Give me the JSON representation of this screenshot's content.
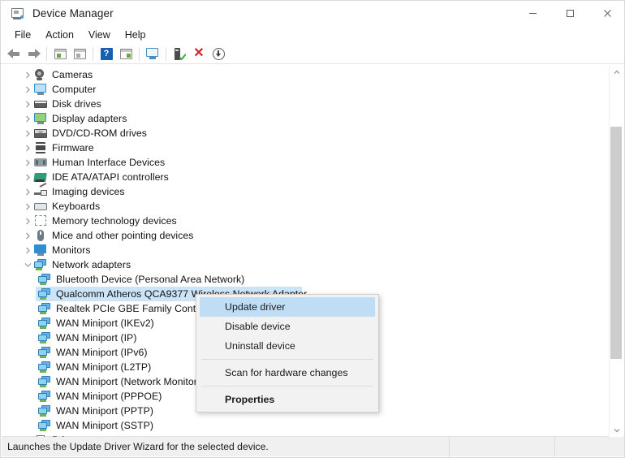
{
  "window": {
    "title": "Device Manager",
    "title_icon": "device-manager-icon",
    "controls": {
      "minimize": "minimize-icon",
      "maximize": "maximize-icon",
      "close": "close-icon"
    }
  },
  "menubar": {
    "items": [
      {
        "label": "File"
      },
      {
        "label": "Action"
      },
      {
        "label": "View"
      },
      {
        "label": "Help"
      }
    ]
  },
  "toolbar": {
    "buttons": [
      {
        "name": "back-button",
        "icon": "back-arrow-icon"
      },
      {
        "name": "forward-button",
        "icon": "forward-arrow-icon"
      },
      {
        "name": "show-hide-console-tree-button",
        "icon": "console-tree-icon"
      },
      {
        "name": "show-hide-action-pane-button",
        "icon": "action-pane-icon"
      },
      {
        "name": "help-button",
        "icon": "help-question-icon"
      },
      {
        "name": "properties-button",
        "icon": "properties-panel-icon"
      },
      {
        "name": "scan-monitor-button",
        "icon": "monitor-icon"
      },
      {
        "name": "update-driver-software-button",
        "icon": "update-driver-green-icon"
      },
      {
        "name": "uninstall-device-button",
        "icon": "red-x-icon"
      },
      {
        "name": "scan-for-hardware-changes-button",
        "icon": "circle-down-arrow-icon"
      }
    ]
  },
  "tree": {
    "nodes": [
      {
        "label": "Cameras",
        "icon": "camera-icon",
        "level": 0,
        "state": "collapsed"
      },
      {
        "label": "Computer",
        "icon": "computer-icon",
        "level": 0,
        "state": "collapsed"
      },
      {
        "label": "Disk drives",
        "icon": "disk-drive-icon",
        "level": 0,
        "state": "collapsed"
      },
      {
        "label": "Display adapters",
        "icon": "display-adapter-icon",
        "level": 0,
        "state": "collapsed"
      },
      {
        "label": "DVD/CD-ROM drives",
        "icon": "dvd-drive-icon",
        "level": 0,
        "state": "collapsed"
      },
      {
        "label": "Firmware",
        "icon": "firmware-icon",
        "level": 0,
        "state": "collapsed"
      },
      {
        "label": "Human Interface Devices",
        "icon": "hid-icon",
        "level": 0,
        "state": "collapsed"
      },
      {
        "label": "IDE ATA/ATAPI controllers",
        "icon": "ide-controller-icon",
        "level": 0,
        "state": "collapsed"
      },
      {
        "label": "Imaging devices",
        "icon": "imaging-device-icon",
        "level": 0,
        "state": "collapsed"
      },
      {
        "label": "Keyboards",
        "icon": "keyboard-icon",
        "level": 0,
        "state": "collapsed"
      },
      {
        "label": "Memory technology devices",
        "icon": "memory-technology-icon",
        "level": 0,
        "state": "collapsed"
      },
      {
        "label": "Mice and other pointing devices",
        "icon": "mouse-icon",
        "level": 0,
        "state": "collapsed"
      },
      {
        "label": "Monitors",
        "icon": "monitor-icon",
        "level": 0,
        "state": "collapsed"
      },
      {
        "label": "Network adapters",
        "icon": "network-adapter-icon",
        "level": 0,
        "state": "expanded"
      },
      {
        "label": "Bluetooth Device (Personal Area Network)",
        "icon": "network-adapter-icon",
        "level": 1,
        "state": "leaf"
      },
      {
        "label": "Qualcomm Atheros QCA9377 Wireless Network Adapter",
        "icon": "network-adapter-icon",
        "level": 1,
        "state": "leaf",
        "selected": true
      },
      {
        "label": "Realtek PCIe GBE Family Controller",
        "icon": "network-adapter-icon",
        "level": 1,
        "state": "leaf"
      },
      {
        "label": "WAN Miniport (IKEv2)",
        "icon": "network-adapter-icon",
        "level": 1,
        "state": "leaf"
      },
      {
        "label": "WAN Miniport (IP)",
        "icon": "network-adapter-icon",
        "level": 1,
        "state": "leaf"
      },
      {
        "label": "WAN Miniport (IPv6)",
        "icon": "network-adapter-icon",
        "level": 1,
        "state": "leaf"
      },
      {
        "label": "WAN Miniport (L2TP)",
        "icon": "network-adapter-icon",
        "level": 1,
        "state": "leaf"
      },
      {
        "label": "WAN Miniport (Network Monitor)",
        "icon": "network-adapter-icon",
        "level": 1,
        "state": "leaf"
      },
      {
        "label": "WAN Miniport (PPPOE)",
        "icon": "network-adapter-icon",
        "level": 1,
        "state": "leaf"
      },
      {
        "label": "WAN Miniport (PPTP)",
        "icon": "network-adapter-icon",
        "level": 1,
        "state": "leaf"
      },
      {
        "label": "WAN Miniport (SSTP)",
        "icon": "network-adapter-icon",
        "level": 1,
        "state": "leaf"
      },
      {
        "label": "Print queues",
        "icon": "printer-icon",
        "level": 0,
        "state": "collapsed"
      }
    ]
  },
  "context_menu": {
    "items": [
      {
        "label": "Update driver",
        "selected": true,
        "bold": false
      },
      {
        "label": "Disable device",
        "selected": false,
        "bold": false
      },
      {
        "label": "Uninstall device",
        "selected": false,
        "bold": false
      },
      {
        "label": "Scan for hardware changes",
        "selected": false,
        "bold": false
      },
      {
        "label": "Properties",
        "selected": false,
        "bold": true
      }
    ]
  },
  "statusbar": {
    "message": "Launches the Update Driver Wizard for the selected device.",
    "cell2": "",
    "cell3": ""
  },
  "scrollbar": {
    "up_arrow": "scroll-up-icon",
    "down_arrow": "scroll-down-icon"
  },
  "colors": {
    "selection": "#cce4f7",
    "menu_selection": "#bfdef5",
    "accent_blue": "#2f8fd0",
    "red": "#d32029",
    "green": "#6cb257",
    "window_bg": "#ffffff",
    "status_bg": "#f0f0f0",
    "menu_bg": "#f2f2f2"
  }
}
